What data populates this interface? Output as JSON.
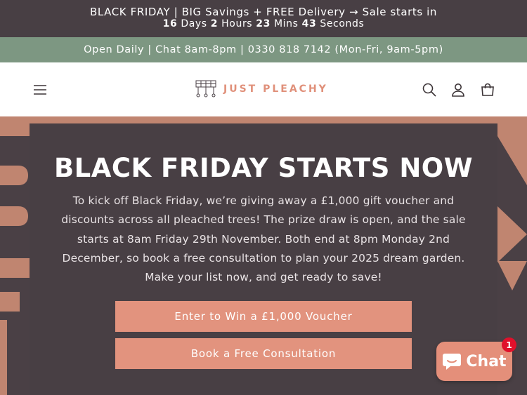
{
  "announcement": {
    "line1": "BLACK FRIDAY | BIG Savings + FREE Delivery → Sale starts in",
    "countdown": {
      "days_value": "16",
      "days_label": "Days",
      "hours_value": "2",
      "hours_label": "Hours",
      "mins_value": "23",
      "mins_label": "Mins",
      "secs_value": "43",
      "secs_label": "Seconds"
    }
  },
  "infobar": {
    "text": "Open Daily | Chat 8am-8pm | 0330 818 7142 (Mon-Fri, 9am-5pm)"
  },
  "header": {
    "logo_text": "JUST PLEACHY",
    "icons": [
      "menu-icon",
      "search-icon",
      "account-icon",
      "cart-icon"
    ]
  },
  "hero": {
    "title": "BLACK FRIDAY STARTS NOW",
    "body": "To kick off Black Friday, we’re giving away a £1,000 gift voucher and discounts across all pleached trees! The prize draw is open, and the sale starts at 8am Friday 29th November. Both end at 8pm Monday 2nd December, so book a free consultation to plan your 2025 dream garden. Make your list now, and get ready to save!",
    "primary_button": "Enter to Win a £1,000 Voucher",
    "secondary_button": "Book a Free Consultation"
  },
  "chat": {
    "label": "Chat",
    "badge_count": "1"
  },
  "colors": {
    "announcement_bg": "#483f44",
    "infobar_bg": "#7d9782",
    "accent": "#e2937e",
    "hero_bg": "#c08570",
    "panel_bg": "#483f44"
  }
}
